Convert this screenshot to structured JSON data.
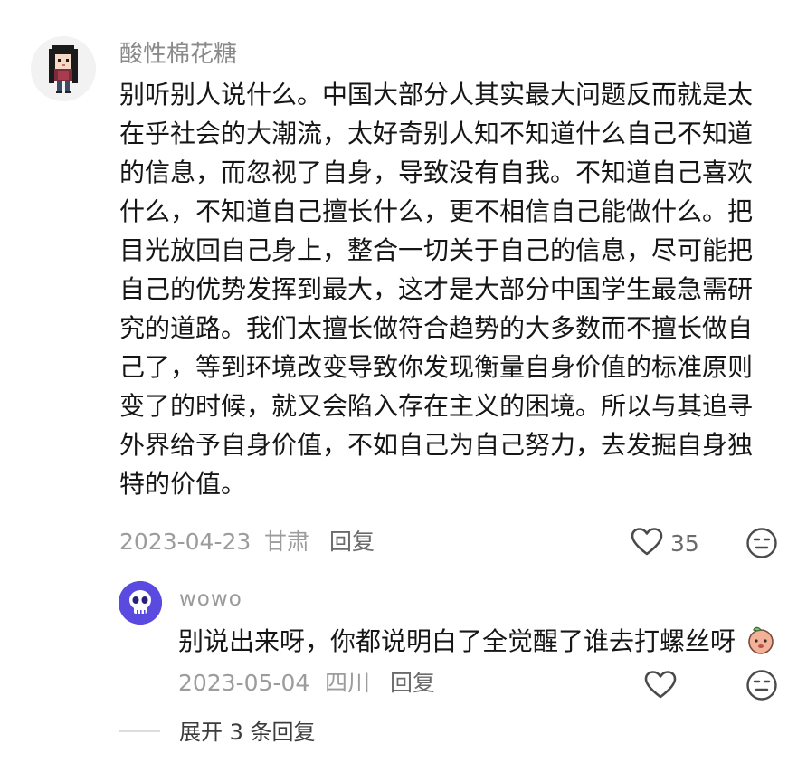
{
  "comment": {
    "username": "酸性棉花糖",
    "lines": [
      "别听别人说什么。中国大部分人其实最大问题反而就是太",
      "在乎社会的大潮流，太好奇别人知不知道什么自己不知道",
      "的信息，而忽视了自身，导致没有自我。不知道自己喜欢",
      "什么，不知道自己擅长什么，更不相信自己能做什么。把",
      "目光放回自己身上，整合一切关于自己的信息，尽可能把",
      "自己的优势发挥到最大，这才是大部分中国学生最急需研",
      "究的道路。我们太擅长做符合趋势的大多数而不擅长做自",
      "己了，等到环境改变导致你发现衡量自身价值的标准原则",
      "变了的时候，就又会陷入存在主义的困境。所以与其追寻",
      "外界给予自身价值，不如自己为自己努力，去发掘自身独",
      "特的价值。"
    ],
    "date": "2023-04-23",
    "location": "甘肃",
    "reply_label": "回复",
    "likes": "35",
    "like_icon": "heart-outline-icon",
    "dislike_icon": "meh-face-icon"
  },
  "reply": {
    "username": "wowo",
    "avatar_icon": "skull-icon",
    "text": "别说出来呀，你都说明白了全觉醒了谁去打螺丝呀",
    "emoji_icon": "peach-emoji-icon",
    "date": "2023-05-04",
    "location": "四川",
    "reply_label": "回复",
    "like_icon": "heart-outline-icon",
    "dislike_icon": "meh-face-icon"
  },
  "expand": {
    "label": "展开 3 条回复"
  },
  "colors": {
    "text": "#161616",
    "secondary": "#9c9c9c",
    "reply_avatar": "#5a4ae0"
  }
}
